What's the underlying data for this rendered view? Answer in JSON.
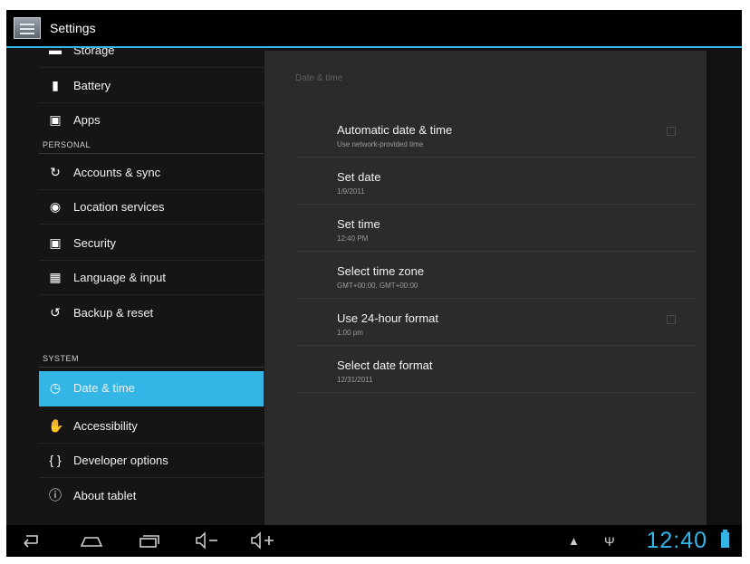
{
  "app": {
    "title": "Settings",
    "icon": "settings-icon"
  },
  "sidebar": {
    "items": [
      {
        "label": "Storage",
        "icon": "storage-icon"
      },
      {
        "label": "Battery",
        "icon": "battery-icon"
      },
      {
        "label": "Apps",
        "icon": "apps-icon"
      },
      {
        "header": "PERSONAL"
      },
      {
        "label": "Accounts & sync",
        "icon": "sync-icon"
      },
      {
        "label": "Location services",
        "icon": "location-icon"
      },
      {
        "label": "Security",
        "icon": "lock-icon"
      },
      {
        "label": "Language & input",
        "icon": "keyboard-icon"
      },
      {
        "label": "Backup & reset",
        "icon": "backup-icon"
      },
      {
        "header": "SYSTEM"
      },
      {
        "label": "Date & time",
        "icon": "clock-icon",
        "selected": true
      },
      {
        "label": "Accessibility",
        "icon": "hand-icon"
      },
      {
        "label": "Developer options",
        "icon": "braces-icon"
      },
      {
        "label": "About tablet",
        "icon": "info-icon"
      }
    ]
  },
  "detail": {
    "section_title": "Date & time",
    "prefs": [
      {
        "title": "Automatic date & time",
        "summary": "Use network-provided time",
        "checkbox": true,
        "checked": false
      },
      {
        "title": "Set date",
        "summary": "1/9/2011"
      },
      {
        "title": "Set time",
        "summary": "12:40 PM"
      },
      {
        "title": "Select time zone",
        "summary": "GMT+00:00, GMT+00:00"
      },
      {
        "title": "Use 24-hour format",
        "summary": "1:00 pm",
        "checkbox": true,
        "checked": false
      },
      {
        "title": "Select date format",
        "summary": "12/31/2011"
      }
    ]
  },
  "statusbar": {
    "back": "back-icon",
    "home": "home-icon",
    "recent": "recent-apps-icon",
    "vol_down": "volume-down-icon",
    "vol_up": "volume-up-icon",
    "android": "android-icon",
    "usb": "usb-icon",
    "time": "12:40",
    "battery": "battery-full-icon"
  },
  "colors": {
    "accent": "#33b5e5",
    "background": "#111111",
    "panel": "#2b2b2b"
  }
}
